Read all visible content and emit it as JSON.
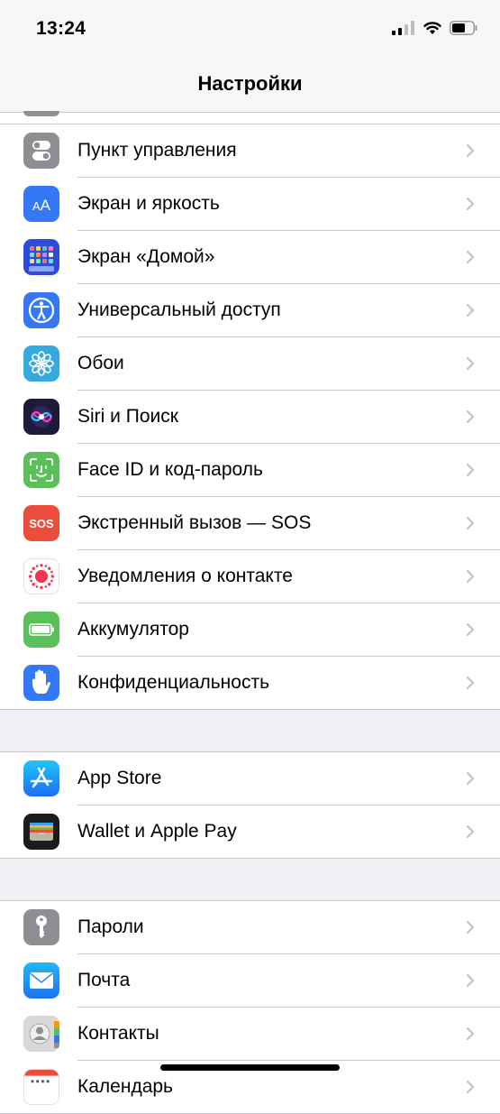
{
  "status": {
    "time": "13:24"
  },
  "nav": {
    "title": "Настройки"
  },
  "groups": [
    {
      "items": [
        {
          "label": "Пункт управления",
          "icon": "control-center-icon",
          "color": "#8e8e93"
        },
        {
          "label": "Экран и яркость",
          "icon": "display-brightness-icon",
          "color": "#3478f6"
        },
        {
          "label": "Экран «Домой»",
          "icon": "home-screen-icon",
          "color": "#2f4cd8"
        },
        {
          "label": "Универсальный доступ",
          "icon": "accessibility-icon",
          "color": "#3478f6"
        },
        {
          "label": "Обои",
          "icon": "wallpaper-icon",
          "color": "#35aadc"
        },
        {
          "label": "Siri и Поиск",
          "icon": "siri-icon",
          "color": "#1c1c3a"
        },
        {
          "label": "Face ID и код-пароль",
          "icon": "face-id-icon",
          "color": "#5ac15a"
        },
        {
          "label": "Экстренный вызов — SOS",
          "icon": "sos-icon",
          "color": "#eb4d3d"
        },
        {
          "label": "Уведомления о контакте",
          "icon": "exposure-notifications-icon",
          "color": "#ffffff"
        },
        {
          "label": "Аккумулятор",
          "icon": "battery-icon",
          "color": "#5ac15a"
        },
        {
          "label": "Конфиденциальность",
          "icon": "privacy-hand-icon",
          "color": "#3478f6"
        }
      ]
    },
    {
      "items": [
        {
          "label": "App Store",
          "icon": "app-store-icon",
          "color": "#2d8cf5"
        },
        {
          "label": "Wallet и Apple Pay",
          "icon": "wallet-icon",
          "color": "#1c1c1e"
        }
      ]
    },
    {
      "items": [
        {
          "label": "Пароли",
          "icon": "key-icon",
          "color": "#8e8e93"
        },
        {
          "label": "Почта",
          "icon": "mail-icon",
          "color": "#2f8cf5"
        },
        {
          "label": "Контакты",
          "icon": "contacts-icon",
          "color": "#d8d8d8"
        },
        {
          "label": "Календарь",
          "icon": "calendar-icon",
          "color": "#ffffff"
        }
      ]
    }
  ]
}
